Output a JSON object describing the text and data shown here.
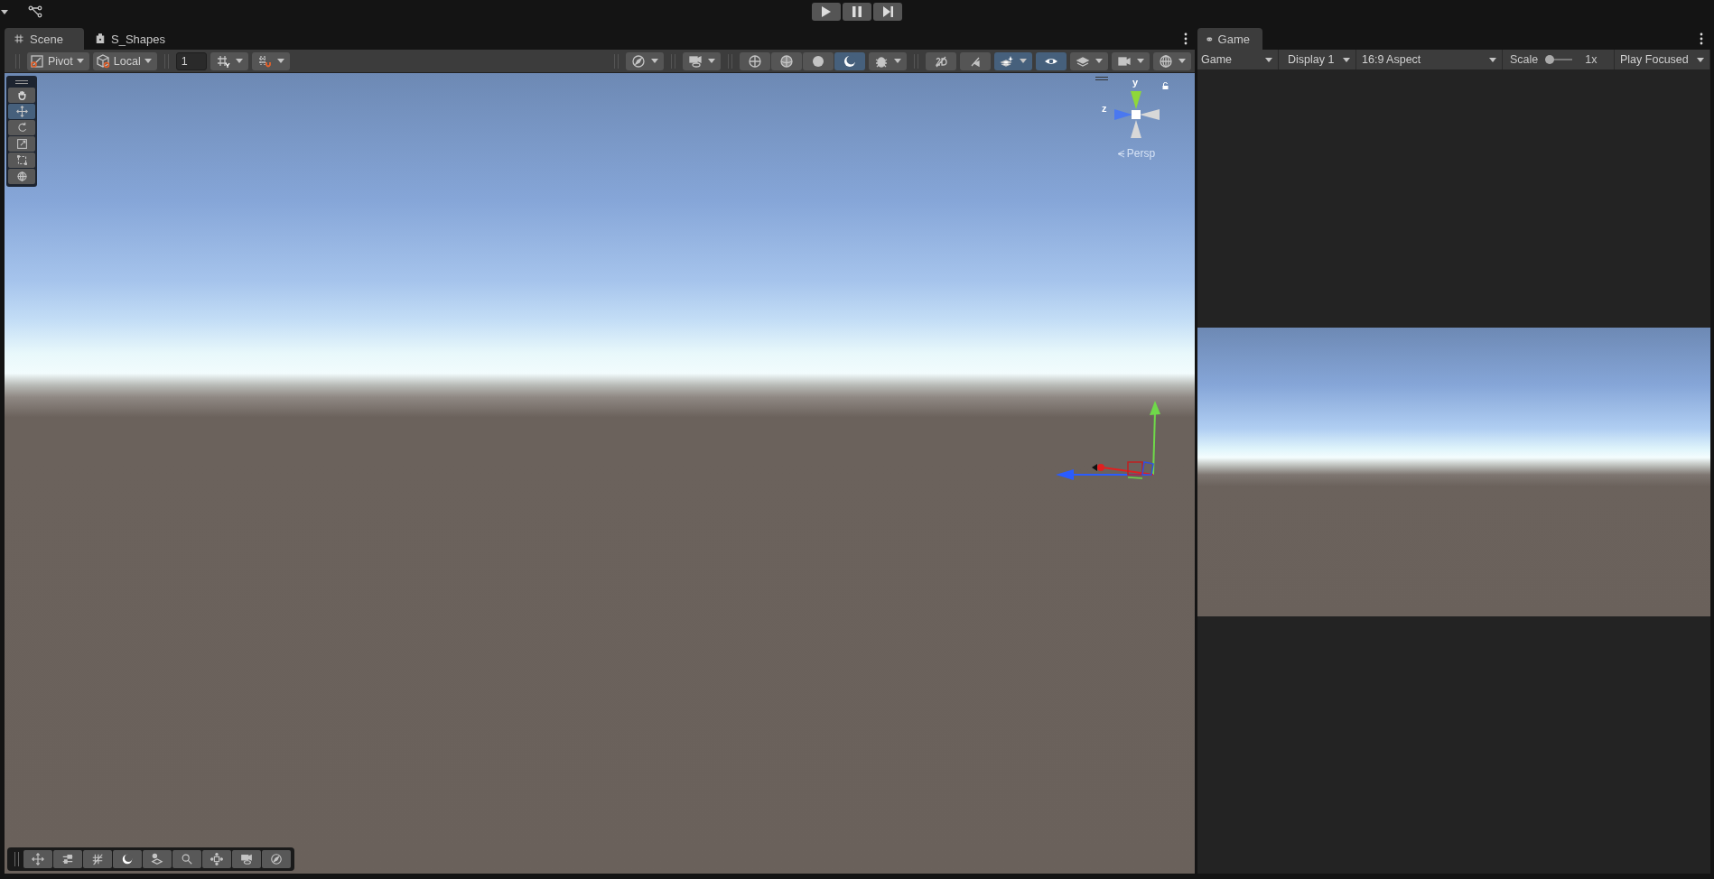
{
  "top_bar": {
    "play_controls": [
      {
        "selected": false
      },
      {
        "selected": false
      },
      {
        "selected": false
      }
    ]
  },
  "scene_panel": {
    "tabs": [
      {
        "label": "Scene",
        "selected": true
      },
      {
        "label": "S_Shapes",
        "selected": false
      }
    ],
    "toolbar": {
      "pivot": {
        "label": "Pivot"
      },
      "space": {
        "label": "Local"
      },
      "grid_increment": {
        "value": "1"
      },
      "buttons": [
        {
          "kind": "split",
          "selected": false
        },
        {
          "kind": "split",
          "selected": false
        },
        {
          "kind": "split",
          "selected": false
        },
        {
          "kind": "split",
          "selected": false
        },
        {
          "kind": "plain",
          "selected": false
        },
        {
          "kind": "plain",
          "selected": false
        },
        {
          "kind": "plain",
          "selected": false
        },
        {
          "kind": "plain",
          "selected": true
        },
        {
          "kind": "split",
          "selected": false
        },
        {
          "kind": "plain",
          "selected": false
        },
        {
          "kind": "plain",
          "selected": false
        },
        {
          "kind": "split",
          "selected": true
        },
        {
          "kind": "plain",
          "selected": true
        },
        {
          "kind": "split",
          "selected": false
        },
        {
          "kind": "split",
          "selected": false
        },
        {
          "kind": "split",
          "selected": false
        }
      ]
    },
    "tools": [
      {
        "selected": false
      },
      {
        "selected": true
      },
      {
        "selected": false
      },
      {
        "selected": false
      },
      {
        "selected": false
      },
      {
        "selected": false
      }
    ],
    "orientation_gizmo": {
      "y_label": "y",
      "z_label": "z",
      "projection": "Persp"
    },
    "overlay_buttons": [
      {
        "selected": false
      },
      {
        "selected": false
      },
      {
        "selected": false
      },
      {
        "selected": false
      },
      {
        "selected": false
      },
      {
        "selected": false
      },
      {
        "selected": false
      },
      {
        "selected": false
      },
      {
        "selected": false
      }
    ]
  },
  "game_panel": {
    "tab": {
      "label": "Game",
      "selected": true
    },
    "toolbar": {
      "view": "Game",
      "display": "Display 1",
      "aspect": "16:9 Aspect",
      "scale_label": "Scale",
      "scale": {
        "level": 0.0
      },
      "scale_value": "1x",
      "play_mode": "Play Focused"
    }
  }
}
